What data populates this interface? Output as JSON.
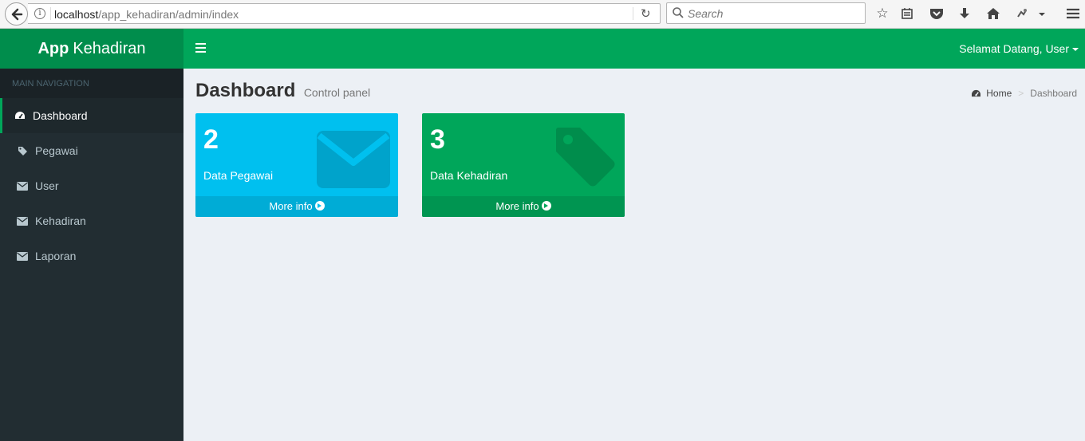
{
  "browser": {
    "url_host": "localhost",
    "url_path": "/app_kehadiran/admin/index",
    "search_placeholder": "Search"
  },
  "app": {
    "logo_bold": "App",
    "logo_rest": "Kehadiran",
    "welcome": "Selamat Datang, User"
  },
  "sidebar": {
    "header": "MAIN NAVIGATION",
    "items": [
      {
        "label": "Dashboard",
        "icon": "dashboard-icon",
        "active": true
      },
      {
        "label": "Pegawai",
        "icon": "tag-icon"
      },
      {
        "label": "User",
        "icon": "envelope-icon"
      },
      {
        "label": "Kehadiran",
        "icon": "envelope-icon"
      },
      {
        "label": "Laporan",
        "icon": "envelope-icon"
      }
    ]
  },
  "content": {
    "title": "Dashboard",
    "subtitle": "Control panel",
    "breadcrumb": {
      "home": "Home",
      "current": "Dashboard"
    }
  },
  "boxes": [
    {
      "value": "2",
      "label": "Data Pegawai",
      "more": "More info",
      "color": "#00c0ef",
      "icon": "envelope-icon"
    },
    {
      "value": "3",
      "label": "Data Kehadiran",
      "more": "More info",
      "color": "#00a65a",
      "icon": "tag-icon"
    }
  ],
  "colors": {
    "accent": "#00a65a",
    "logo_bg": "#008d4c",
    "sidebar_bg": "#222d32",
    "aqua": "#00c0ef",
    "content_bg": "#ecf0f5"
  }
}
